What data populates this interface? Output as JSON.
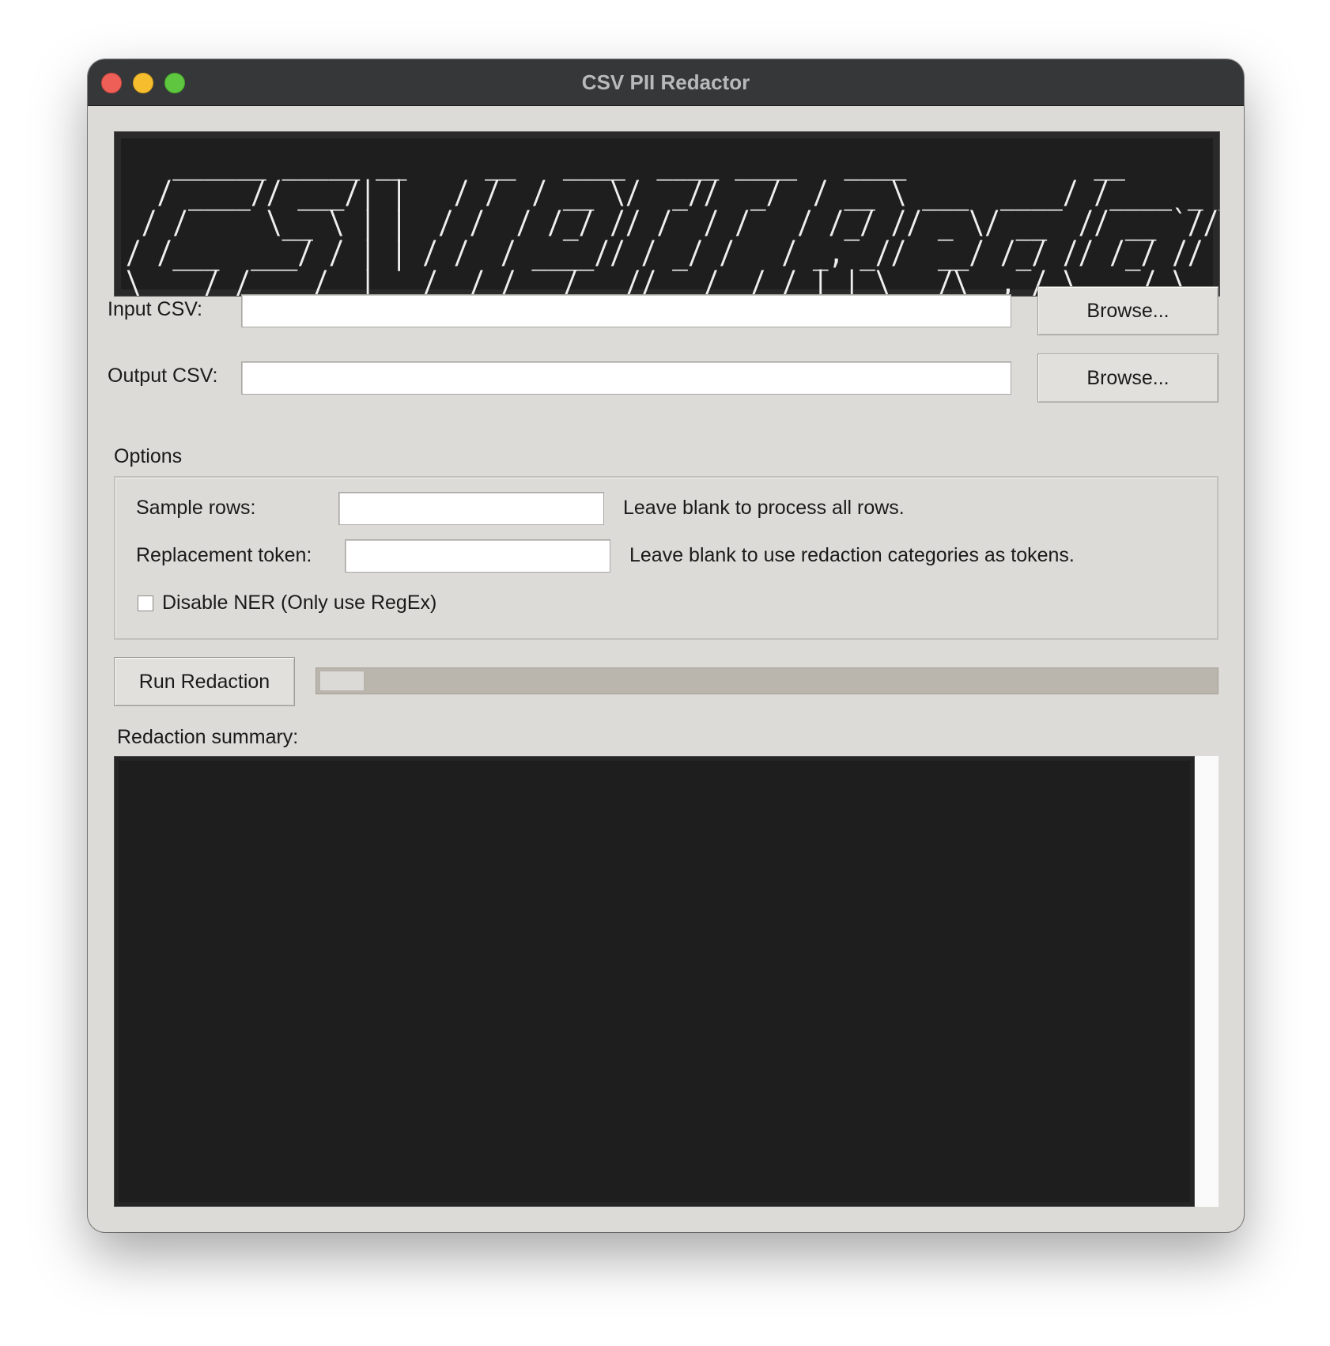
{
  "window": {
    "title": "CSV PII Redactor"
  },
  "banner": {
    "ascii_art": "   ______ _____ __     __   ____  ____ ____   ____            __              __                ____   ____   ____   ____ \n  / ____// ___/| |   / /  / __ \\/  _//  _/  / __ \\ ___  ____/ /____ _ _____ / /_ ____   _____ / __ \\ / __ \\ / __ \\ / __ \\\n / /     \\__ \\ | |  / /  / /_/ // /  / /   / /_/ // _ \\/ __  // __ `// ___// __// __ \\ / ___// /_/ // / / // / / // / / /\n/ /___  ___/ / | | / /  / ____// / _/ /   / _, _//  __/ /_/ // /_/ // /__ / /_ / /_/ // /    \\__, // /_/ // /_/ // /_/ / \n\\____/ /____/  |___/  /_/   /___//___/  /_/ |_| \\___/\\__,_/ \\__,_/ \\___/ \\__/ \\____//_/    /____/ \\____/ \\____/ \\____/  "
  },
  "input_csv": {
    "label": "Input CSV:",
    "value": "",
    "browse_label": "Browse..."
  },
  "output_csv": {
    "label": "Output CSV:",
    "value": "",
    "browse_label": "Browse..."
  },
  "options": {
    "title": "Options",
    "sample_rows": {
      "label": "Sample rows:",
      "value": "",
      "hint": "Leave blank to process all rows."
    },
    "replacement_token": {
      "label": "Replacement token:",
      "value": "",
      "hint": "Leave blank to use redaction categories as tokens."
    },
    "disable_ner": {
      "label": "Disable NER (Only use RegEx)",
      "checked": false
    }
  },
  "run": {
    "button_label": "Run Redaction",
    "progress_fraction": 0.05
  },
  "summary": {
    "label": "Redaction summary:",
    "content": ""
  },
  "colors": {
    "window_bg": "#dddbd7",
    "titlebar_bg": "#363739",
    "console_bg": "#1e1e1e",
    "progress_trough": "#bbb6ad"
  }
}
